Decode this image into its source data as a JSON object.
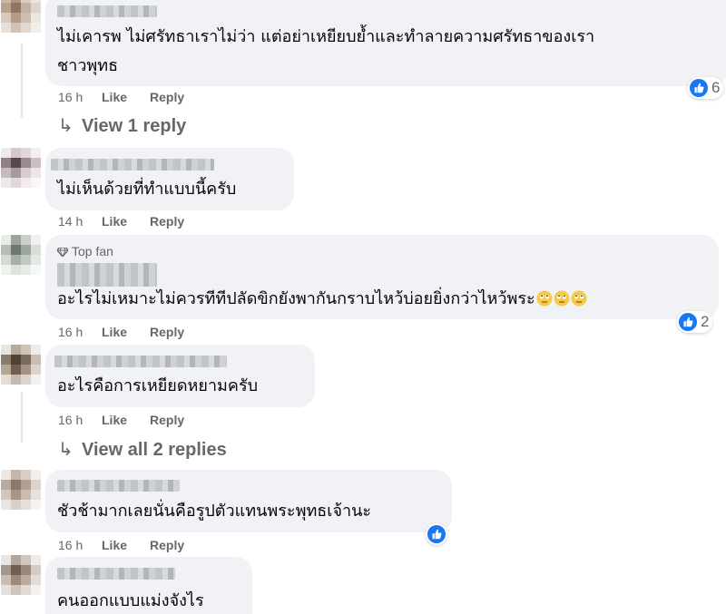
{
  "colors": {
    "bubble": "#f0f2f5",
    "meta_text": "#65676b",
    "like_blue": "#1877f2",
    "text": "#050505"
  },
  "icons": {
    "like": "thumbs-up-icon",
    "top_fan": "diamond-icon",
    "reply_arrow": "reply-arrow-icon",
    "emoji": "rolling-eyes-emoji"
  },
  "comments": [
    {
      "text_lines": [
        "ไม่เคารพ ไม่ศรัทธาเราไม่ว่า แต่อย่าเหยียบย้ำและทำลายความศรัทธาของเรา",
        "ชาวพุทธ"
      ],
      "time": "16 h",
      "like_label": "Like",
      "reply_label": "Reply",
      "reactions": "6",
      "view_replies": "View 1 reply"
    },
    {
      "text_lines": [
        "ไม่เห็นด้วยที่ทำแบบนี้ครับ"
      ],
      "time": "14 h",
      "like_label": "Like",
      "reply_label": "Reply"
    },
    {
      "badge": "Top fan",
      "text_lines": [
        "อะไรไม่เหมาะไม่ควรทีทีปลัดขิกยังพากันกราบไหว้บ่อยยิ่งกว่าไหว้พระ"
      ],
      "time": "16 h",
      "like_label": "Like",
      "reply_label": "Reply",
      "reactions": "2"
    },
    {
      "text_lines": [
        "อะไรคือการเหยียดหยามครับ"
      ],
      "time": "16 h",
      "like_label": "Like",
      "reply_label": "Reply",
      "view_replies": "View all 2 replies"
    },
    {
      "text_lines": [
        "ชัวช้ามากเลยนั่นคือรูปตัวแทนพระพุทธเจ้านะ"
      ],
      "time": "16 h",
      "like_label": "Like",
      "reply_label": "Reply",
      "reactions": ""
    },
    {
      "text_lines": [
        "คนออกแบบแม่งจังไร"
      ]
    }
  ]
}
